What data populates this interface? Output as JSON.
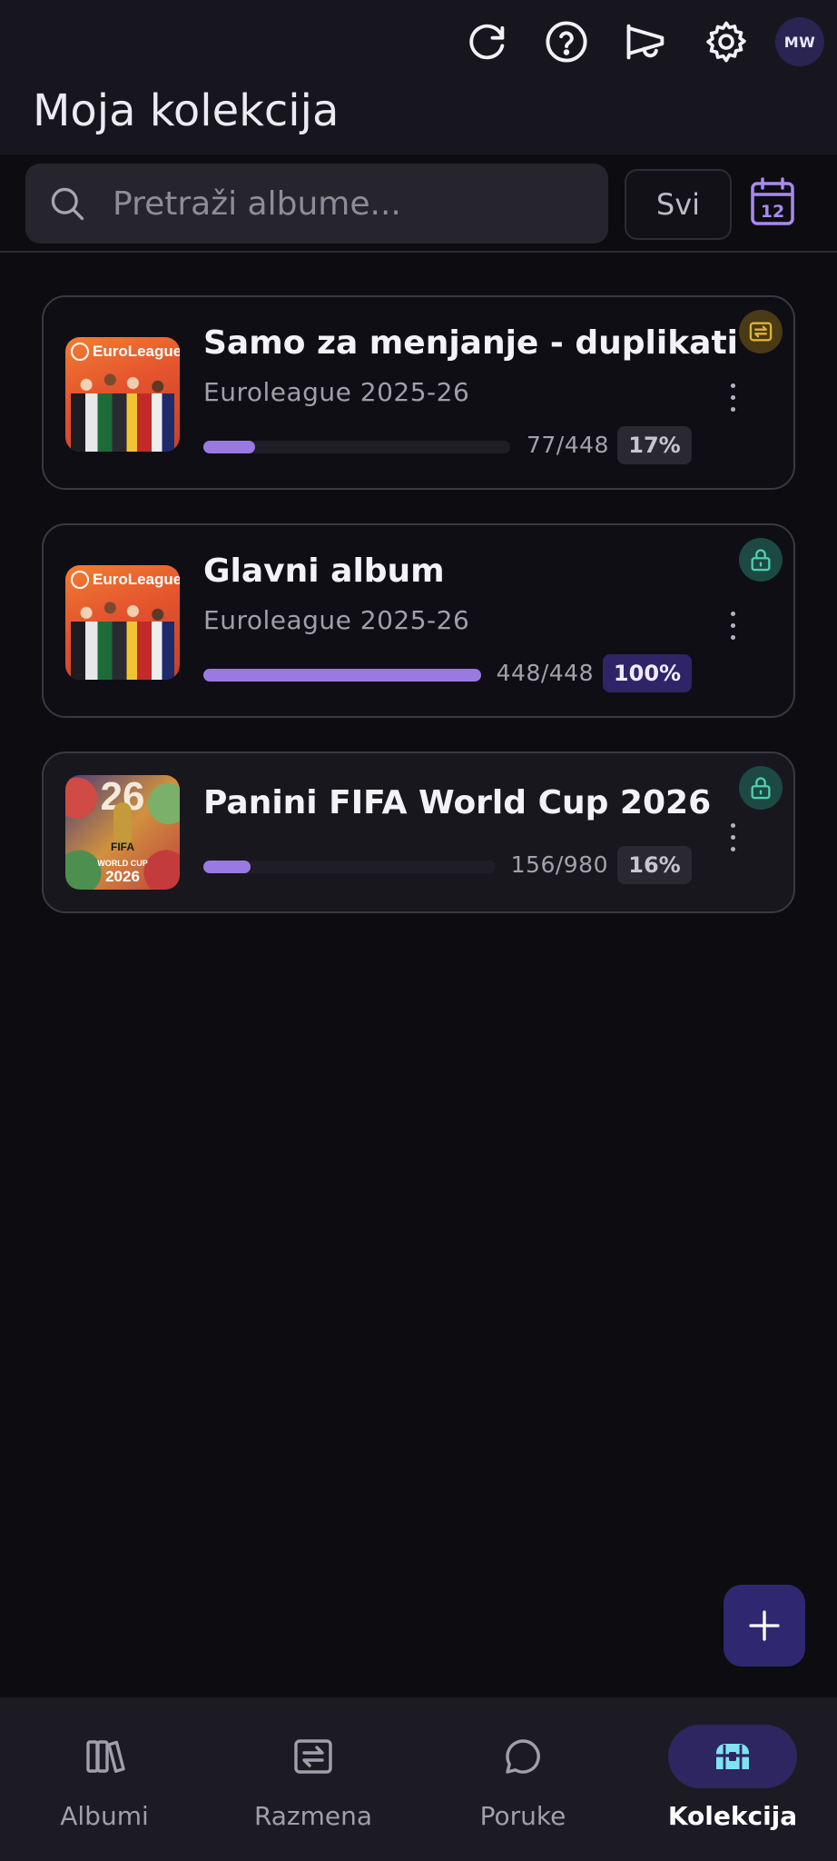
{
  "header": {
    "title": "Moja kolekcija",
    "avatar_initials": "MW",
    "icons": [
      "refresh-icon",
      "help-icon",
      "megaphone-icon",
      "settings-icon"
    ]
  },
  "search": {
    "placeholder": "Pretraži albume...",
    "value": "",
    "filter_label": "Svi",
    "calendar_day": "12"
  },
  "albums": [
    {
      "title": "Samo za menjanje - duplikati",
      "subtitle": "Euroleague 2025-26",
      "count": "77/448",
      "percent_label": "17%",
      "progress": 0.17,
      "badge": "swap-icon",
      "thumb_logo": "EuroLeague"
    },
    {
      "title": "Glavni album",
      "subtitle": "Euroleague 2025-26",
      "count": "448/448",
      "percent_label": "100%",
      "progress": 1.0,
      "badge": "lock-icon",
      "thumb_logo": "EuroLeague"
    },
    {
      "title": "Panini FIFA World Cup 2026",
      "subtitle": "",
      "count": "156/980",
      "percent_label": "16%",
      "progress": 0.16,
      "badge": "lock-icon",
      "thumb_logo": "FIFA",
      "thumb_sub": "WORLD CUP",
      "thumb_year": "2026",
      "thumb_numeral": "26"
    }
  ],
  "nav": {
    "items": [
      {
        "label": "Albumi",
        "icon": "books-icon",
        "active": false
      },
      {
        "label": "Razmena",
        "icon": "swap-icon",
        "active": false
      },
      {
        "label": "Poruke",
        "icon": "chat-bubble-icon",
        "active": false
      },
      {
        "label": "Kolekcija",
        "icon": "chest-icon",
        "active": true
      }
    ]
  },
  "colors": {
    "accent": "#9a7ae0",
    "active_pill": "#2e2660",
    "background": "#0d0c11"
  }
}
